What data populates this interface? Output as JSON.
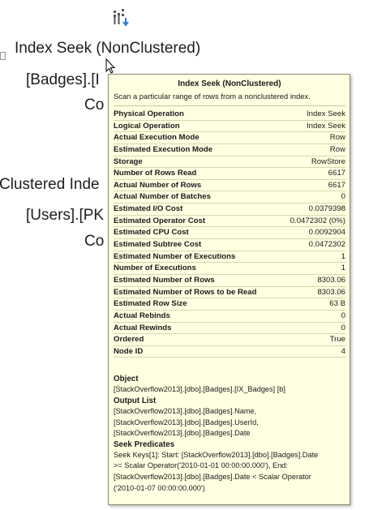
{
  "plan_node": {
    "icon": "index-seek-operator-icon",
    "line1": "Index Seek (NonClustered)",
    "line2": "[Badges].[I",
    "line3": "Co",
    "line4": "Clustered  Inde",
    "line5": "[Users].[PK",
    "line6": "Co"
  },
  "tooltip": {
    "title": "Index Seek (NonClustered)",
    "description": "Scan a particular range of rows from a nonclustered index.",
    "properties": [
      {
        "label": "Physical Operation",
        "value": "Index Seek"
      },
      {
        "label": "Logical Operation",
        "value": "Index Seek"
      },
      {
        "label": "Actual Execution Mode",
        "value": "Row"
      },
      {
        "label": "Estimated Execution Mode",
        "value": "Row"
      },
      {
        "label": "Storage",
        "value": "RowStore"
      },
      {
        "label": "Number of Rows Read",
        "value": "6617"
      },
      {
        "label": "Actual Number of Rows",
        "value": "6617"
      },
      {
        "label": "Actual Number of Batches",
        "value": "0"
      },
      {
        "label": "Estimated I/O Cost",
        "value": "0.0379398"
      },
      {
        "label": "Estimated Operator Cost",
        "value": "0.0472302 (0%)"
      },
      {
        "label": "Estimated CPU Cost",
        "value": "0.0092904"
      },
      {
        "label": "Estimated Subtree Cost",
        "value": "0.0472302"
      },
      {
        "label": "Estimated Number of Executions",
        "value": "1"
      },
      {
        "label": "Number of Executions",
        "value": "1"
      },
      {
        "label": "Estimated Number of Rows",
        "value": "8303.06"
      },
      {
        "label": "Estimated Number of Rows to be Read",
        "value": "8303.06"
      },
      {
        "label": "Estimated Row Size",
        "value": "63 B"
      },
      {
        "label": "Actual Rebinds",
        "value": "0"
      },
      {
        "label": "Actual Rewinds",
        "value": "0"
      },
      {
        "label": "Ordered",
        "value": "True"
      },
      {
        "label": "Node ID",
        "value": "4"
      }
    ],
    "object_heading": "Object",
    "object_value": "[StackOverflow2013].[dbo].[Badges].[IX_Badges] [b]",
    "output_heading": "Output List",
    "output_lines": [
      "[StackOverflow2013].[dbo].[Badges].Name,",
      "[StackOverflow2013].[dbo].[Badges].UserId,",
      "[StackOverflow2013].[dbo].[Badges].Date"
    ],
    "seek_heading": "Seek Predicates",
    "seek_lines": [
      "Seek Keys[1]: Start: [StackOverflow2013].[dbo].[Badges].Date",
      ">= Scalar Operator('2010-01-01 00:00:00.000'), End:",
      "[StackOverflow2013].[dbo].[Badges].Date < Scalar Operator",
      "('2010-01-07 00:00:00.000')"
    ]
  }
}
